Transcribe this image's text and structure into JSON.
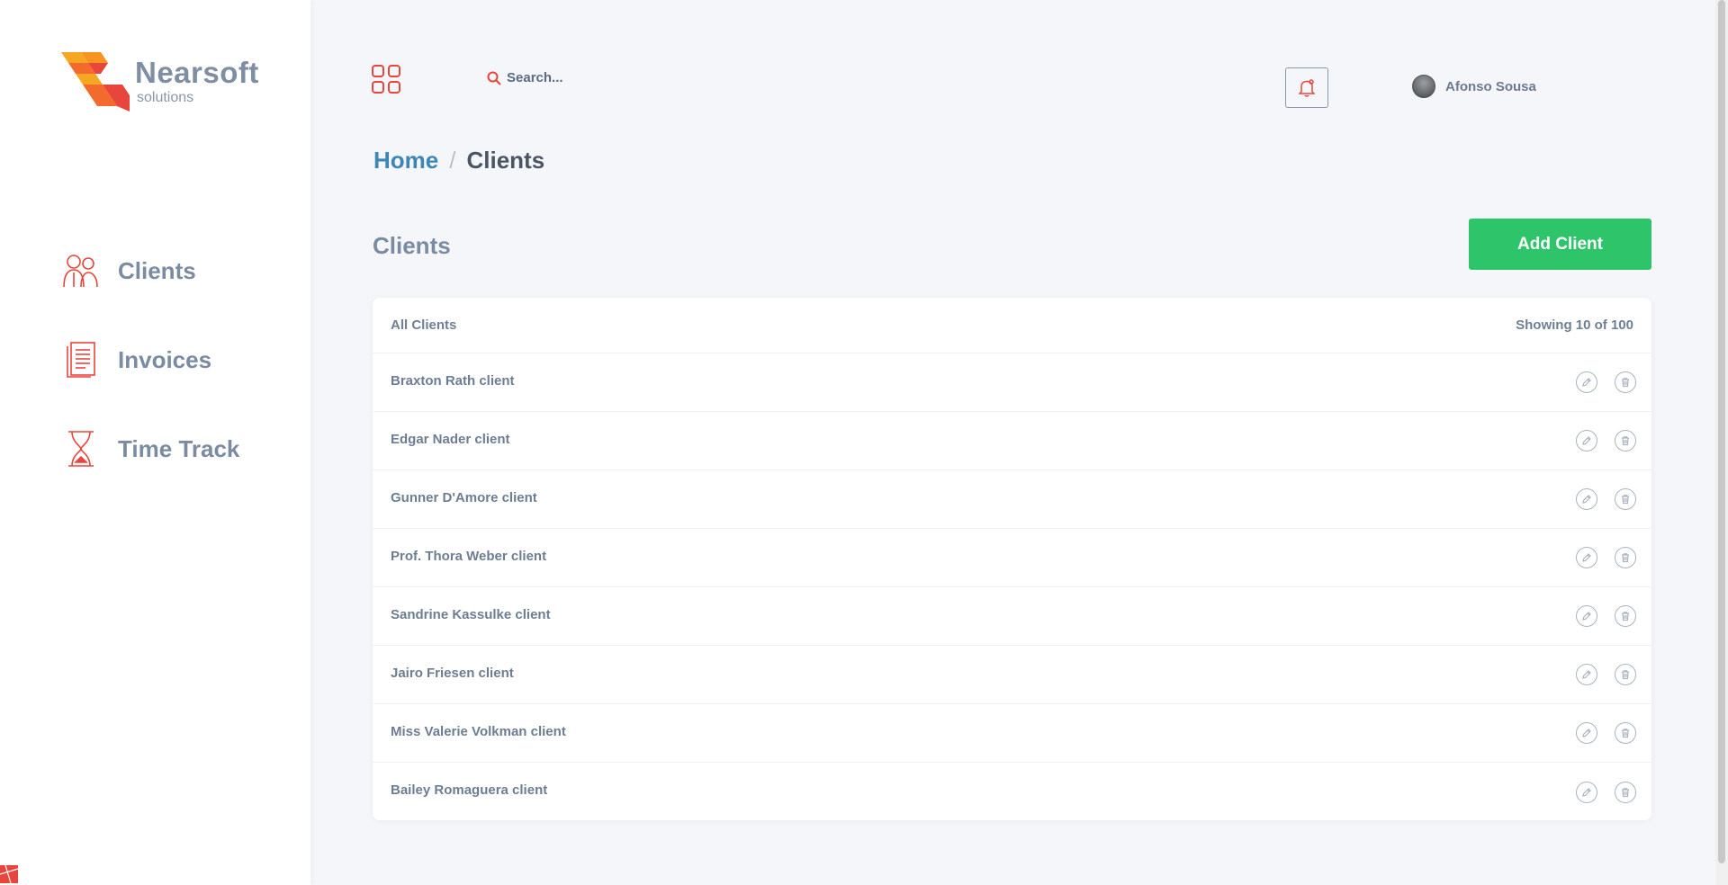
{
  "brand": {
    "name": "Nearsoft",
    "subtitle": "solutions"
  },
  "sidebar": {
    "items": [
      {
        "label": "Clients",
        "icon": "clients-icon"
      },
      {
        "label": "Invoices",
        "icon": "invoices-icon"
      },
      {
        "label": "Time Track",
        "icon": "hourglass-icon"
      }
    ]
  },
  "header": {
    "search_placeholder": "Search...",
    "user_name": "Afonso Sousa"
  },
  "breadcrumb": {
    "home": "Home",
    "separator": "/",
    "current": "Clients"
  },
  "main": {
    "title": "Clients",
    "add_button": "Add Client",
    "list_title": "All Clients",
    "count_text": "Showing 10 of 100",
    "clients": [
      "Braxton Rath client",
      "Edgar Nader client",
      "Gunner D'Amore client",
      "Prof. Thora Weber client",
      "Sandrine Kassulke client",
      "Jairo Friesen client",
      "Miss Valerie Volkman client",
      "Bailey Romaguera client"
    ]
  },
  "colors": {
    "accent_red": "#e8453c",
    "accent_orange": "#f5a623",
    "primary_green": "#2ec56a",
    "link_blue": "#3d86b8",
    "text_gray": "#7b8ba1"
  }
}
